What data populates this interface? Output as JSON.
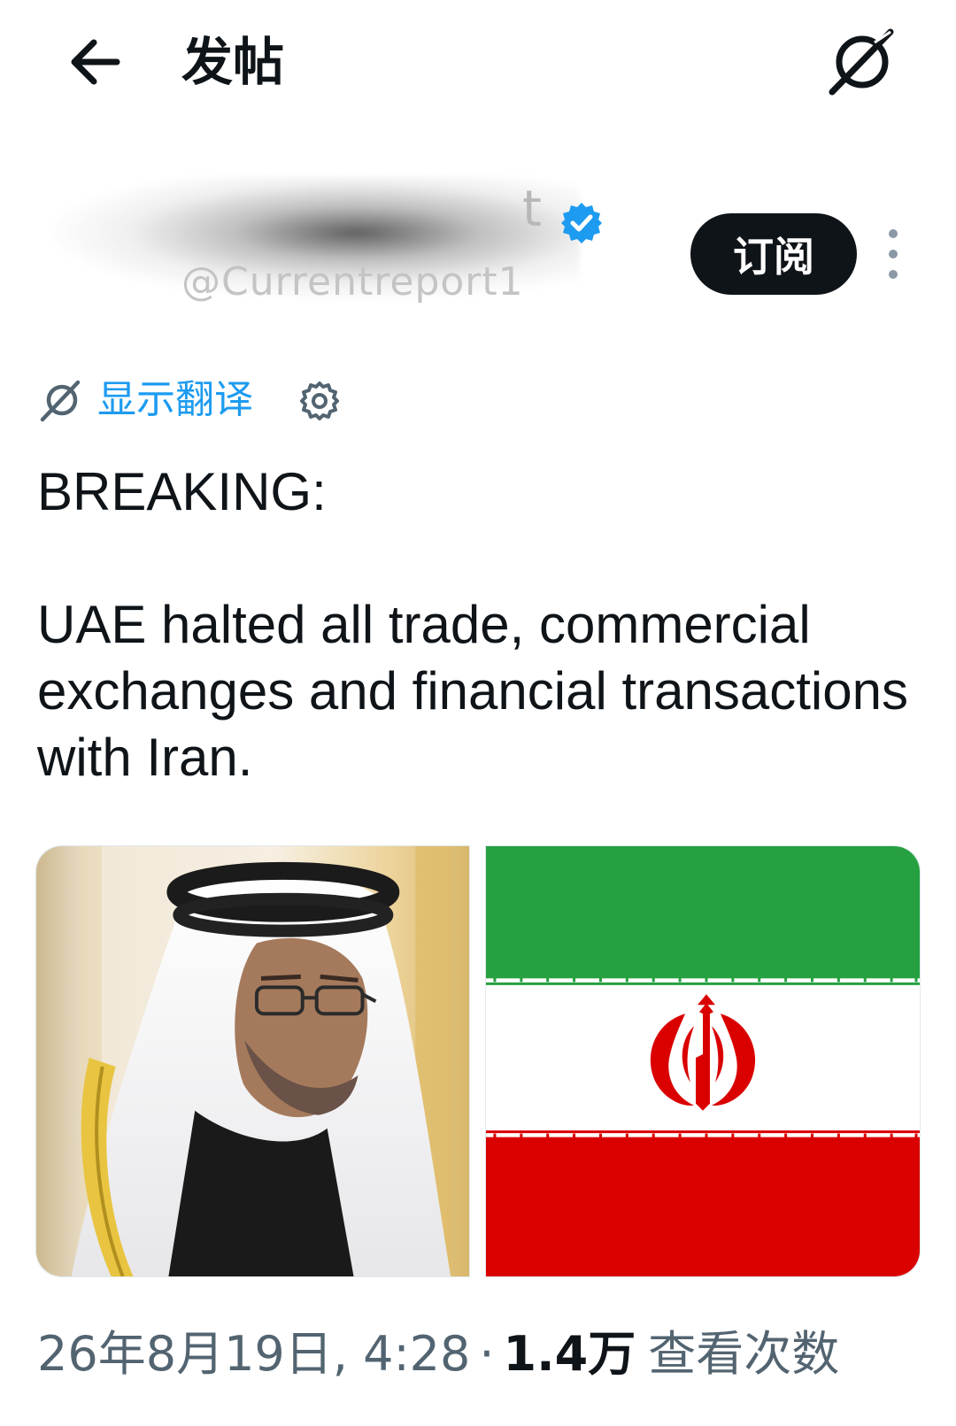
{
  "header": {
    "title": "发帖",
    "back_label": "back-arrow-icon",
    "grok_icon": "grok-icon"
  },
  "author": {
    "name_visible_tail": "t",
    "handle": "@Currentreport1",
    "verified": true,
    "verified_color": "#1d9bf0",
    "subscribe_label": "订阅",
    "more_icon": "more-vertical-icon"
  },
  "translate": {
    "label": "显示翻译",
    "icon": "grok-icon",
    "settings_icon": "gear-icon",
    "link_color": "#1d9bf0"
  },
  "tweet": {
    "text": "BREAKING:\n\nUAE halted all trade, commercial exchanges and financial transactions with Iran."
  },
  "media": [
    {
      "name": "photo-of-man-in-white-headdress"
    },
    {
      "name": "iran-flag"
    }
  ],
  "meta": {
    "timestamp": "26年8月19日, 4:28",
    "separator": "·",
    "views_count": "1.4万",
    "views_label": "查看次数"
  }
}
